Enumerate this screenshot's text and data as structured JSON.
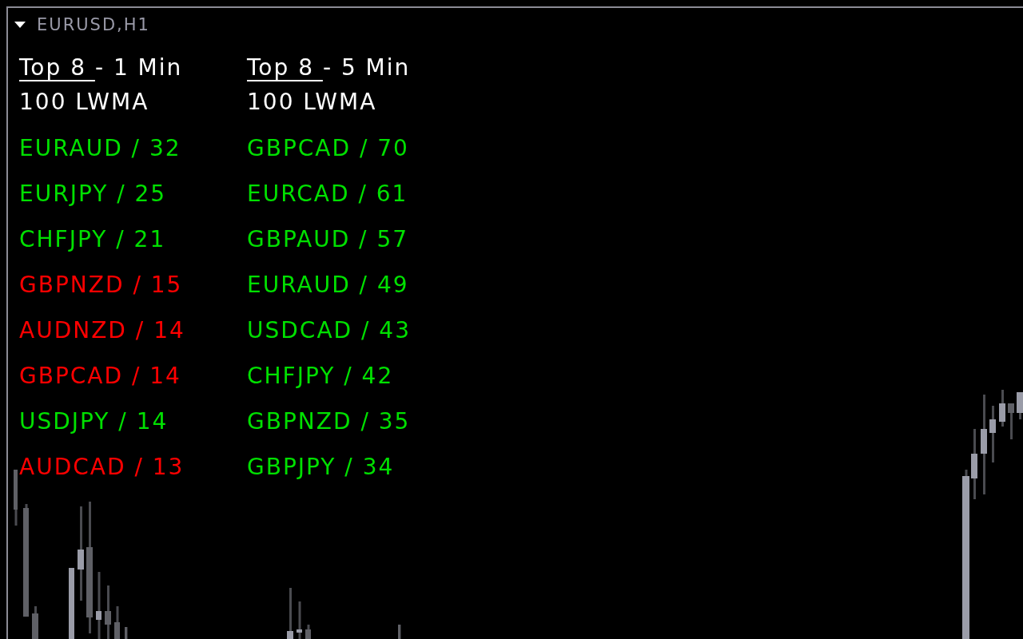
{
  "chart_window": {
    "title": "EURUSD,H1"
  },
  "panels": [
    {
      "heading": "Top 8",
      "heading_suffix": " - 1 Min",
      "subheading": "100 LWMA",
      "rows": [
        {
          "label": "EURAUD / 32",
          "color": "#00e000"
        },
        {
          "label": "EURJPY / 25",
          "color": "#00e000"
        },
        {
          "label": "CHFJPY / 21",
          "color": "#00e000"
        },
        {
          "label": "GBPNZD / 15",
          "color": "#ff0000"
        },
        {
          "label": "AUDNZD / 14",
          "color": "#ff0000"
        },
        {
          "label": "GBPCAD / 14",
          "color": "#ff0000"
        },
        {
          "label": "USDJPY / 14",
          "color": "#00e000"
        },
        {
          "label": "AUDCAD / 13",
          "color": "#ff0000"
        }
      ]
    },
    {
      "heading": "Top 8",
      "heading_suffix": " - 5 Min",
      "subheading": "100 LWMA",
      "rows": [
        {
          "label": "GBPCAD / 70",
          "color": "#00e000"
        },
        {
          "label": "EURCAD / 61",
          "color": "#00e000"
        },
        {
          "label": "GBPAUD / 57",
          "color": "#00e000"
        },
        {
          "label": "EURAUD / 49",
          "color": "#00e000"
        },
        {
          "label": "USDCAD / 43",
          "color": "#00e000"
        },
        {
          "label": "CHFJPY / 42",
          "color": "#00e000"
        },
        {
          "label": "GBPNZD / 35",
          "color": "#00e000"
        },
        {
          "label": "GBPJPY / 34",
          "color": "#00e000"
        }
      ]
    }
  ]
}
